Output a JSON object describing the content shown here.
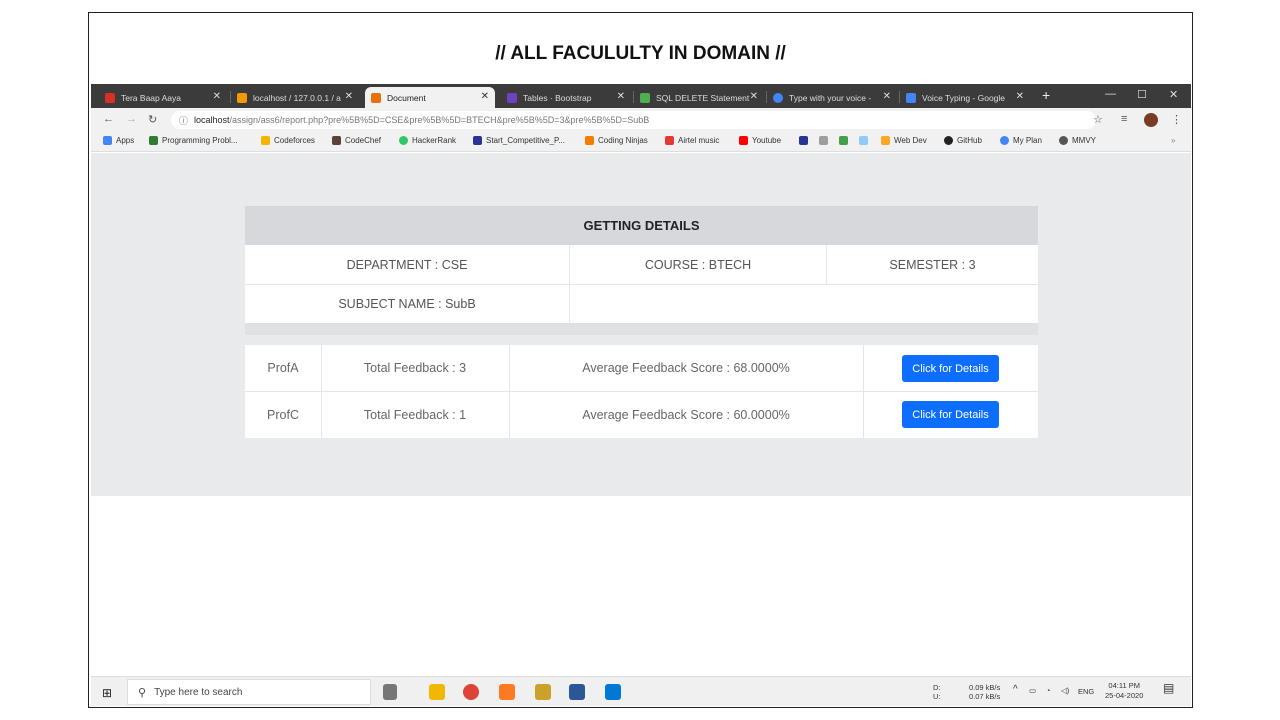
{
  "slide": {
    "title": "// ALL FACULULTY IN DOMAIN //"
  },
  "tabs": [
    {
      "label": "Tera Baap Aaya",
      "color": "#d93025"
    },
    {
      "label": "localhost / 127.0.0.1 / a",
      "color": "#f29900"
    },
    {
      "label": "Document",
      "color": "#e8710a"
    },
    {
      "label": "Tables · Bootstrap",
      "color": "#6f42c1"
    },
    {
      "label": "SQL DELETE Statement",
      "color": "#4caf50"
    },
    {
      "label": "Type with your voice -",
      "color": "#4285f4"
    },
    {
      "label": "Voice Typing - Google",
      "color": "#4285f4"
    }
  ],
  "address": {
    "host": "localhost",
    "path": "/assign/ass6/report.php?pre%5B%5D=CSE&pre%5B%5D=BTECH&pre%5B%5D=3&pre%5B%5D=SubB"
  },
  "bookmarks": [
    {
      "label": "Apps",
      "color": "#4285f4"
    },
    {
      "label": "Programming Probl...",
      "color": "#2e7d32"
    },
    {
      "label": "Codeforces",
      "color": "#f4b400"
    },
    {
      "label": "CodeChef",
      "color": "#5d4037"
    },
    {
      "label": "HackerRank",
      "color": "#2ec866"
    },
    {
      "label": "Start_Competitive_P...",
      "color": "#283593"
    },
    {
      "label": "Coding Ninjas",
      "color": "#f57c00"
    },
    {
      "label": "Airtel music",
      "color": "#e53935"
    },
    {
      "label": "Youtube",
      "color": "#ff0000"
    },
    {
      "label": "Web Dev",
      "color": "#f9a825"
    },
    {
      "label": "GitHub",
      "color": "#222222"
    },
    {
      "label": "My Plan",
      "color": "#4285f4"
    },
    {
      "label": "MMVY",
      "color": "#555555"
    }
  ],
  "details": {
    "heading": "GETTING DETAILS",
    "department": "DEPARTMENT : CSE",
    "course": "COURSE : BTECH",
    "semester": "SEMESTER : 3",
    "subject": "SUBJECT NAME : SubB"
  },
  "faculty": [
    {
      "name": "ProfA",
      "total": "Total Feedback : 3",
      "avg": "Average Feedback Score : 68.0000%",
      "button": "Click for Details"
    },
    {
      "name": "ProfC",
      "total": "Total Feedback : 1",
      "avg": "Average Feedback Score : 60.0000%",
      "button": "Click for Details"
    }
  ],
  "taskbar": {
    "search_placeholder": "Type here to search",
    "net_d": "D:",
    "net_u": "U:",
    "net_down": "0.09 kB/s",
    "net_up": "0.07 kB/s",
    "lang": "ENG",
    "time": "04:11 PM",
    "date": "25-04-2020"
  },
  "colors": {
    "accent": "#0d6efd",
    "page_bg": "#e8eaec",
    "header_bg": "#d6d8db"
  }
}
